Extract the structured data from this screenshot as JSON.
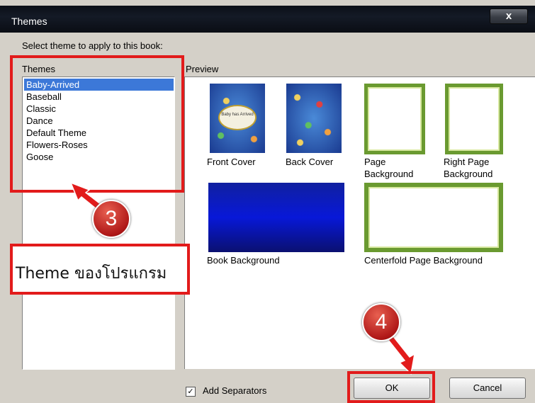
{
  "window": {
    "title": "Themes",
    "close_glyph": "x"
  },
  "instruction": "Select theme to apply to this book:",
  "themes_panel": {
    "label": "Themes",
    "items": [
      "Baby-Arrived",
      "Baseball",
      "Classic",
      "Dance",
      "Default Theme",
      "Flowers-Roses",
      "Goose"
    ],
    "selected_index": 0
  },
  "preview": {
    "label": "Preview",
    "front_cover_text": "Baby has Arrived",
    "thumbnails": {
      "front_cover": "Front Cover",
      "back_cover": "Back Cover",
      "page_background": "Page Background",
      "right_page_background": "Right Page Background",
      "book_background": "Book Background",
      "centerfold": "Centerfold Page Background"
    }
  },
  "options": {
    "add_separators_label": "Add Separators",
    "add_separators_checked": true,
    "check_glyph": "✓"
  },
  "buttons": {
    "ok": "OK",
    "cancel": "Cancel"
  },
  "annotations": {
    "step_3": "3",
    "step_4": "4",
    "label_text": "Theme ของโปรแกรม",
    "highlight_color": "#e21b1b"
  },
  "colors": {
    "selection": "#3c78d8",
    "dialog_bg": "#d4d0c8"
  }
}
